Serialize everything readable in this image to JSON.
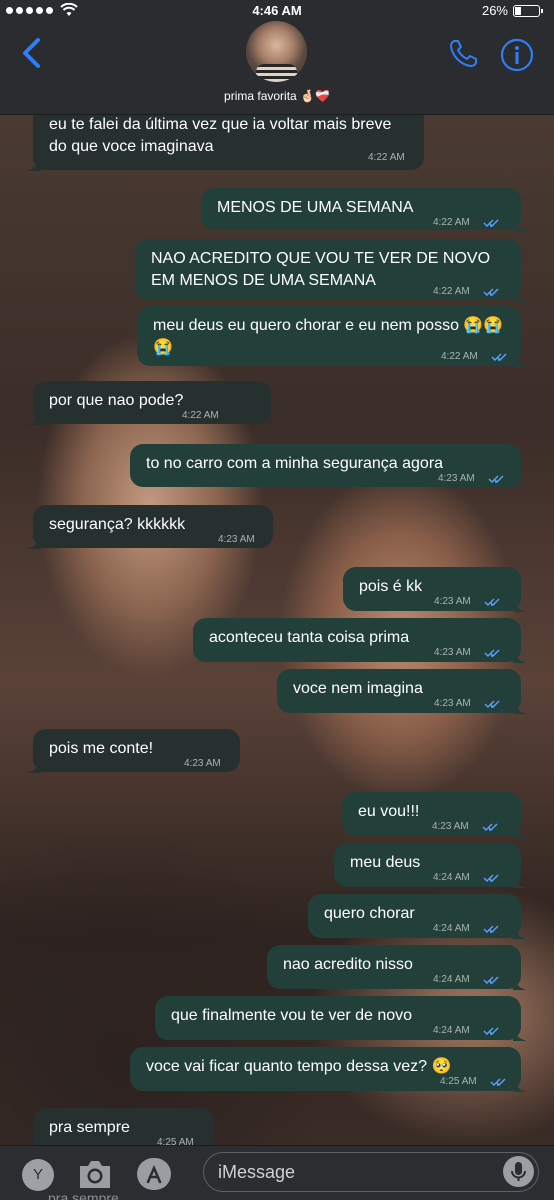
{
  "status_bar": {
    "time": "4:46 AM",
    "battery": "26%",
    "battery_level": 0.26
  },
  "header": {
    "contact_name": "prima favorita 🤞🏻❤️‍🩹"
  },
  "colors": {
    "accent": "#2d7ff9",
    "bubble_out": "#224039",
    "bubble_in": "#26302f",
    "check": "#5aa0ff"
  },
  "messages": [
    {
      "dir": "in",
      "text": "eu te falei da última vez que ia voltar mais breve\ndo que voce imaginava",
      "time": "4:22 AM"
    },
    {
      "dir": "out",
      "text": "MENOS DE UMA SEMANA",
      "time": "4:22 AM"
    },
    {
      "dir": "out",
      "text": "NAO ACREDITO QUE VOU TE VER DE NOVO\nEM MENOS DE UMA SEMANA",
      "time": "4:22 AM"
    },
    {
      "dir": "out",
      "text": "meu deus eu quero chorar e eu nem posso 😭😭\n😭",
      "time": "4:22 AM"
    },
    {
      "dir": "in",
      "text": "por que nao pode?",
      "time": "4:22 AM"
    },
    {
      "dir": "out",
      "text": "to no carro com a minha segurança agora",
      "time": "4:23 AM"
    },
    {
      "dir": "in",
      "text": "segurança? kkkkkk",
      "time": "4:23 AM"
    },
    {
      "dir": "out",
      "text": "pois é kk",
      "time": "4:23 AM"
    },
    {
      "dir": "out",
      "text": "aconteceu tanta coisa prima",
      "time": "4:23 AM"
    },
    {
      "dir": "out",
      "text": "voce nem imagina",
      "time": "4:23 AM"
    },
    {
      "dir": "in",
      "text": "pois me conte!",
      "time": "4:23 AM"
    },
    {
      "dir": "out",
      "text": "eu vou!!!",
      "time": "4:23 AM"
    },
    {
      "dir": "out",
      "text": "meu deus",
      "time": "4:24 AM"
    },
    {
      "dir": "out",
      "text": "quero chorar",
      "time": "4:24 AM"
    },
    {
      "dir": "out",
      "text": "nao acredito nisso",
      "time": "4:24 AM"
    },
    {
      "dir": "out",
      "text": "que finalmente vou te ver de novo",
      "time": "4:24 AM"
    },
    {
      "dir": "out",
      "text": "voce vai ficar quanto tempo dessa vez? 🥺",
      "time": "4:25 AM"
    },
    {
      "dir": "in",
      "text": "pra sempre",
      "time": "4:25 AM"
    }
  ],
  "input_bar": {
    "app_button": "Y",
    "placeholder": "iMessage",
    "peek_text": "pra sempre"
  }
}
